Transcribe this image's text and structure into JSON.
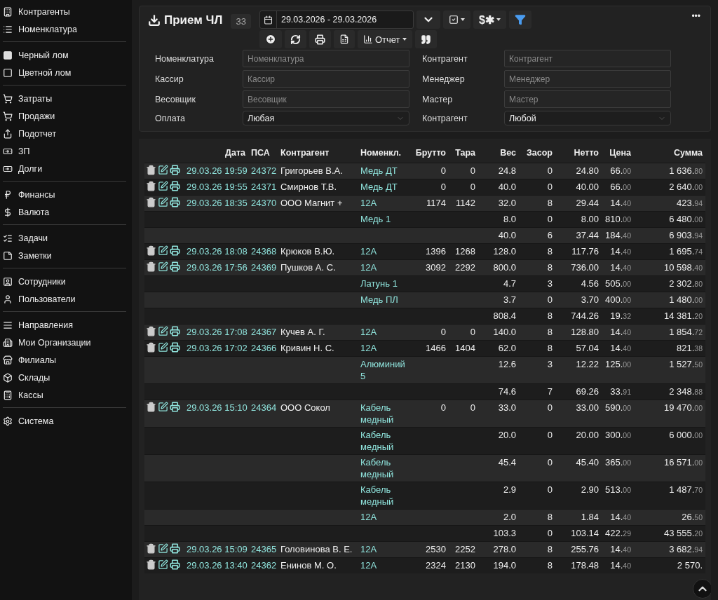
{
  "sidebar": {
    "groups": [
      {
        "items": [
          {
            "label": "Контрагенты"
          },
          {
            "label": "Номенклатура"
          }
        ]
      },
      {
        "items": [
          {
            "label": "Черный лом"
          },
          {
            "label": "Цветной лом"
          }
        ]
      },
      {
        "items": [
          {
            "label": "Затраты"
          },
          {
            "label": "Продажи"
          },
          {
            "label": "Подотчет"
          },
          {
            "label": "ЗП"
          },
          {
            "label": "Долги"
          }
        ]
      },
      {
        "items": [
          {
            "label": "Финансы"
          },
          {
            "label": "Валюта"
          }
        ]
      },
      {
        "items": [
          {
            "label": "Задачи"
          },
          {
            "label": "Заметки"
          }
        ]
      },
      {
        "items": [
          {
            "label": "Сотрудники"
          },
          {
            "label": "Пользователи"
          }
        ]
      },
      {
        "items": [
          {
            "label": "Направления"
          },
          {
            "label": "Мои Организации"
          },
          {
            "label": "Филиалы"
          },
          {
            "label": "Склады"
          },
          {
            "label": "Кассы"
          }
        ]
      },
      {
        "items": [
          {
            "label": "Система"
          }
        ]
      }
    ]
  },
  "header": {
    "title": "Прием ЧЛ",
    "count": "33",
    "date_range": "29.03.2026 - 29.03.2026",
    "currency_button": "$✱",
    "report_button": "Отчет",
    "more": "•••"
  },
  "filters": [
    {
      "label": "Номенклатура",
      "kind": "input",
      "placeholder": "Номенклатура"
    },
    {
      "label": "Контрагент",
      "kind": "input",
      "placeholder": "Контрагент"
    },
    {
      "label": "Кассир",
      "kind": "input",
      "placeholder": "Кассир"
    },
    {
      "label": "Менеджер",
      "kind": "input",
      "placeholder": "Менеджер"
    },
    {
      "label": "Весовщик",
      "kind": "input",
      "placeholder": "Весовщик"
    },
    {
      "label": "Мастер",
      "kind": "input",
      "placeholder": "Мастер"
    },
    {
      "label": "Оплата",
      "kind": "select",
      "value": "Любая"
    },
    {
      "label": "Контрагент",
      "kind": "select",
      "value": "Любой"
    }
  ],
  "table": {
    "columns": [
      "Дата",
      "ПСА",
      "Контрагент",
      "Номенкл.",
      "Брутто",
      "Тара",
      "Вес",
      "Засор",
      "Нетто",
      "Цена",
      "Сумма"
    ],
    "rows": [
      {
        "kind": "main",
        "date": "29.03.26 19:59",
        "psa": "24372",
        "contragent": "Григорьев В.А.",
        "nom": "Медь ДТ",
        "brutto": "0",
        "tara": "0",
        "ves": "24.8",
        "zasor": "0",
        "netto": "24.80",
        "price": "66.00",
        "sum": "1 636.80"
      },
      {
        "kind": "main",
        "date": "29.03.26 19:55",
        "psa": "24371",
        "contragent": "Смирнов Т.В.",
        "nom": "Медь ДТ",
        "brutto": "0",
        "tara": "0",
        "ves": "40.0",
        "zasor": "0",
        "netto": "40.00",
        "price": "66.00",
        "sum": "2 640.00"
      },
      {
        "kind": "main",
        "date": "29.03.26 18:35",
        "psa": "24370",
        "contragent": "ООО Магнит +",
        "nom": "12А",
        "brutto": "1174",
        "tara": "1142",
        "ves": "32.0",
        "zasor": "8",
        "netto": "29.44",
        "price": "14.40",
        "sum": "423.94"
      },
      {
        "kind": "sub",
        "nom": "Медь 1",
        "ves": "8.0",
        "zasor": "0",
        "netto": "8.00",
        "price": "810.00",
        "sum": "6 480.00"
      },
      {
        "kind": "total",
        "ves": "40.0",
        "zasor": "6",
        "netto": "37.44",
        "price": "184.40",
        "sum": "6 903.94"
      },
      {
        "kind": "main",
        "date": "29.03.26 18:08",
        "psa": "24368",
        "contragent": "Крюков В.Ю.",
        "nom": "12А",
        "brutto": "1396",
        "tara": "1268",
        "ves": "128.0",
        "zasor": "8",
        "netto": "117.76",
        "price": "14.40",
        "sum": "1 695.74"
      },
      {
        "kind": "main",
        "date": "29.03.26 17:56",
        "psa": "24369",
        "contragent": "Пушков А. С.",
        "nom": "12А",
        "brutto": "3092",
        "tara": "2292",
        "ves": "800.0",
        "zasor": "8",
        "netto": "736.00",
        "price": "14.40",
        "sum": "10 598.40"
      },
      {
        "kind": "sub",
        "nom": "Латунь 1",
        "ves": "4.7",
        "zasor": "3",
        "netto": "4.56",
        "price": "505.00",
        "sum": "2 302.80"
      },
      {
        "kind": "sub",
        "nom": "Медь ПЛ",
        "ves": "3.7",
        "zasor": "0",
        "netto": "3.70",
        "price": "400.00",
        "sum": "1 480.00"
      },
      {
        "kind": "total",
        "ves": "808.4",
        "zasor": "8",
        "netto": "744.26",
        "price": "19.32",
        "sum": "14 381.20"
      },
      {
        "kind": "main",
        "date": "29.03.26 17:08",
        "psa": "24367",
        "contragent": "Кучев А. Г.",
        "nom": "12А",
        "brutto": "0",
        "tara": "0",
        "ves": "140.0",
        "zasor": "8",
        "netto": "128.80",
        "price": "14.40",
        "sum": "1 854.72"
      },
      {
        "kind": "main",
        "date": "29.03.26 17:02",
        "psa": "24366",
        "contragent": "Кривин Н. С.",
        "nom": "12А",
        "brutto": "1466",
        "tara": "1404",
        "ves": "62.0",
        "zasor": "8",
        "netto": "57.04",
        "price": "14.40",
        "sum": "821.38"
      },
      {
        "kind": "sub",
        "nom": "Алюминий 5",
        "ves": "12.6",
        "zasor": "3",
        "netto": "12.22",
        "price": "125.00",
        "sum": "1 527.50"
      },
      {
        "kind": "total",
        "ves": "74.6",
        "zasor": "7",
        "netto": "69.26",
        "price": "33.91",
        "sum": "2 348.88"
      },
      {
        "kind": "main",
        "date": "29.03.26 15:10",
        "psa": "24364",
        "contragent": "ООО Сокол",
        "nom": "Кабель медный",
        "brutto": "0",
        "tara": "0",
        "ves": "33.0",
        "zasor": "0",
        "netto": "33.00",
        "price": "590.00",
        "sum": "19 470.00"
      },
      {
        "kind": "sub",
        "nom": "Кабель медный",
        "ves": "20.0",
        "zasor": "0",
        "netto": "20.00",
        "price": "300.00",
        "sum": "6 000.00"
      },
      {
        "kind": "sub",
        "nom": "Кабель медный",
        "ves": "45.4",
        "zasor": "0",
        "netto": "45.40",
        "price": "365.00",
        "sum": "16 571.00"
      },
      {
        "kind": "sub",
        "nom": "Кабель медный",
        "ves": "2.9",
        "zasor": "0",
        "netto": "2.90",
        "price": "513.00",
        "sum": "1 487.70"
      },
      {
        "kind": "sub",
        "nom": "12А",
        "ves": "2.0",
        "zasor": "8",
        "netto": "1.84",
        "price": "14.40",
        "sum": "26.50"
      },
      {
        "kind": "total",
        "ves": "103.3",
        "zasor": "0",
        "netto": "103.14",
        "price": "422.29",
        "sum": "43 555.20"
      },
      {
        "kind": "main",
        "date": "29.03.26 15:09",
        "psa": "24365",
        "contragent": "Головинова В. Е.",
        "nom": "12А",
        "brutto": "2530",
        "tara": "2252",
        "ves": "278.0",
        "zasor": "8",
        "netto": "255.76",
        "price": "14.40",
        "sum": "3 682.94"
      },
      {
        "kind": "main",
        "date": "29.03.26 13:40",
        "psa": "24362",
        "contragent": "Енинов М. О.",
        "nom": "12А",
        "brutto": "2324",
        "tara": "2130",
        "ves": "194.0",
        "zasor": "8",
        "netto": "178.48",
        "price": "14.40",
        "sum": "2 570."
      }
    ]
  }
}
